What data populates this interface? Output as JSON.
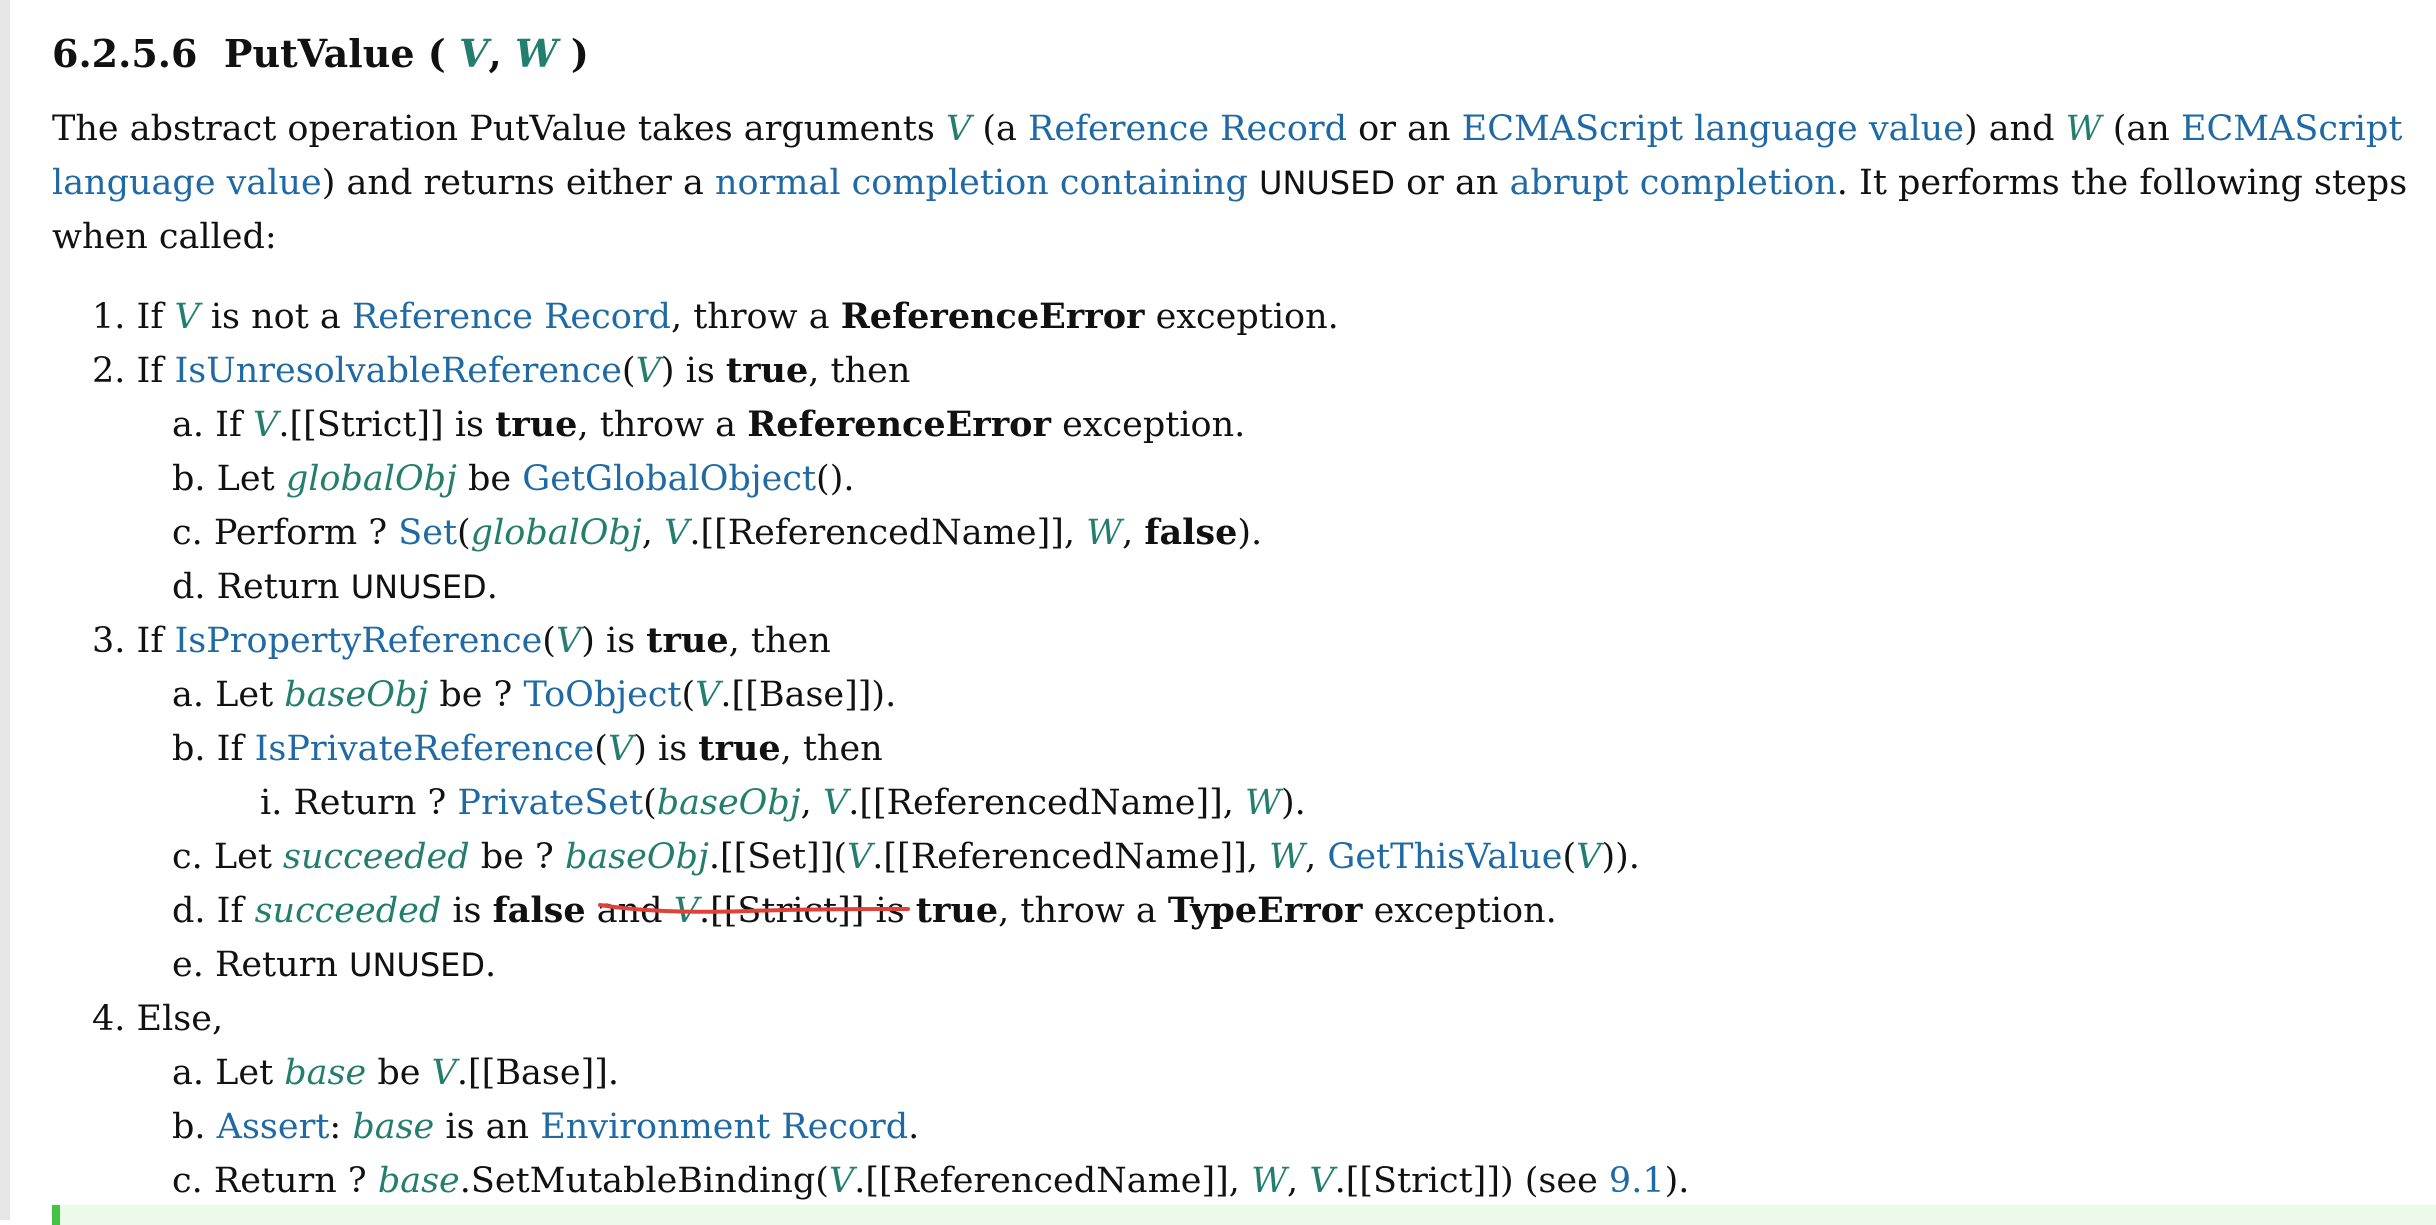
{
  "title": {
    "number": "6.2.5.6",
    "name": "PutValue (",
    "v": "V",
    "comma": ",",
    "w": "W",
    "close": ")"
  },
  "colors": {
    "variable": "#237e6e",
    "link": "#1f6aa5",
    "underline": "#e0423a",
    "note": "#ecfbe9",
    "note_border": "#43c343"
  },
  "intro": {
    "t1": "The abstract operation PutValue takes arguments ",
    "v": "V",
    "t2": " (a ",
    "ref_record": "Reference Record",
    "t3": " or an ",
    "ecma_value_1": "ECMAScript language value",
    "t4": ") and ",
    "w": "W",
    "t5": " (an ",
    "ecma_value_2": "ECMAScript language value",
    "t6": ") and returns either a ",
    "normal_completion": "normal completion containing",
    "t7": " ",
    "unused": "UNUSED",
    "t8": " or an ",
    "abrupt_completion": "abrupt completion",
    "t9": ". It performs the following steps when called:"
  },
  "steps": {
    "s1": {
      "marker": "1.",
      "t1": " If ",
      "v": "V",
      "t2": " is not a ",
      "ref_record": "Reference Record",
      "t3": ", throw a ",
      "err": "ReferenceError",
      "t4": " exception."
    },
    "s2": {
      "marker": "2.",
      "t1": " If ",
      "fn": "IsUnresolvableReference",
      "t2": "(",
      "v": "V",
      "t3": ") is ",
      "true": "true",
      "t4": ", then"
    },
    "s2a": {
      "marker": "a.",
      "t1": " If ",
      "v": "V",
      "t2": ".[[Strict]] is ",
      "true": "true",
      "t3": ", throw a ",
      "err": "ReferenceError",
      "t4": " exception."
    },
    "s2b": {
      "marker": "b.",
      "t1": " Let ",
      "global_obj": "globalObj",
      "t2": " be ",
      "fn": "GetGlobalObject",
      "t3": "()."
    },
    "s2c": {
      "marker": "c.",
      "t1": " Perform ? ",
      "fn": "Set",
      "t2": "(",
      "global_obj": "globalObj",
      "t3": ", ",
      "v": "V",
      "t4": ".[[ReferencedName]], ",
      "w": "W",
      "t5": ", ",
      "false": "false",
      "t6": ")."
    },
    "s2d": {
      "marker": "d.",
      "t1": " Return ",
      "unused": "UNUSED",
      "t2": "."
    },
    "s3": {
      "marker": "3.",
      "t1": " If ",
      "fn": "IsPropertyReference",
      "t2": "(",
      "v": "V",
      "t3": ") is ",
      "true": "true",
      "t4": ", then"
    },
    "s3a": {
      "marker": "a.",
      "t1": " Let ",
      "base_obj": "baseObj",
      "t2": " be ? ",
      "fn": "ToObject",
      "t3": "(",
      "v": "V",
      "t4": ".[[Base]])."
    },
    "s3b": {
      "marker": "b.",
      "t1": " If ",
      "fn": "IsPrivateReference",
      "t2": "(",
      "v": "V",
      "t3": ") is ",
      "true": "true",
      "t4": ", then"
    },
    "s3bi": {
      "marker": "i.",
      "t1": " Return ? ",
      "fn": "PrivateSet",
      "t2": "(",
      "base_obj": "baseObj",
      "t3": ", ",
      "v": "V",
      "t4": ".[[ReferencedName]], ",
      "w": "W",
      "t5": ")."
    },
    "s3c": {
      "marker": "c.",
      "t1": " Let ",
      "succeeded": "succeeded",
      "t2": " be ? ",
      "base_obj": "baseObj",
      "t3": ".[[Set]](",
      "v": "V",
      "t4": ".[[ReferencedName]], ",
      "w": "W",
      "t5": ", ",
      "fn": "GetThisValue",
      "t6": "(",
      "v2": "V",
      "t7": "))."
    },
    "s3d": {
      "marker": "d.",
      "t1": " If ",
      "succeeded": "succeeded",
      "t2": " is ",
      "false": "false",
      "t3": " and ",
      "v": "V",
      "t4": ".[[Strict]] is ",
      "true": "true",
      "t5": ", throw a ",
      "err": "TypeError",
      "t6": " exception."
    },
    "s3e": {
      "marker": "e.",
      "t1": " Return ",
      "unused": "UNUSED",
      "t2": "."
    },
    "s4": {
      "marker": "4.",
      "t1": " Else,"
    },
    "s4a": {
      "marker": "a.",
      "t1": " Let ",
      "base": "base",
      "t2": " be ",
      "v": "V",
      "t3": ".[[Base]]."
    },
    "s4b": {
      "marker": "b.",
      "assert": "Assert",
      "t1": ": ",
      "base": "base",
      "t2": " is an ",
      "env_record": "Environment Record",
      "t3": "."
    },
    "s4c": {
      "marker": "c.",
      "t1": " Return ? ",
      "base": "base",
      "t2": ".SetMutableBinding(",
      "v": "V",
      "t3": ".[[ReferencedName]], ",
      "w": "W",
      "t4": ", ",
      "v2": "V",
      "t5": ".[[Strict]]) (see ",
      "see_ref": "9.1",
      "t6": ")."
    }
  }
}
